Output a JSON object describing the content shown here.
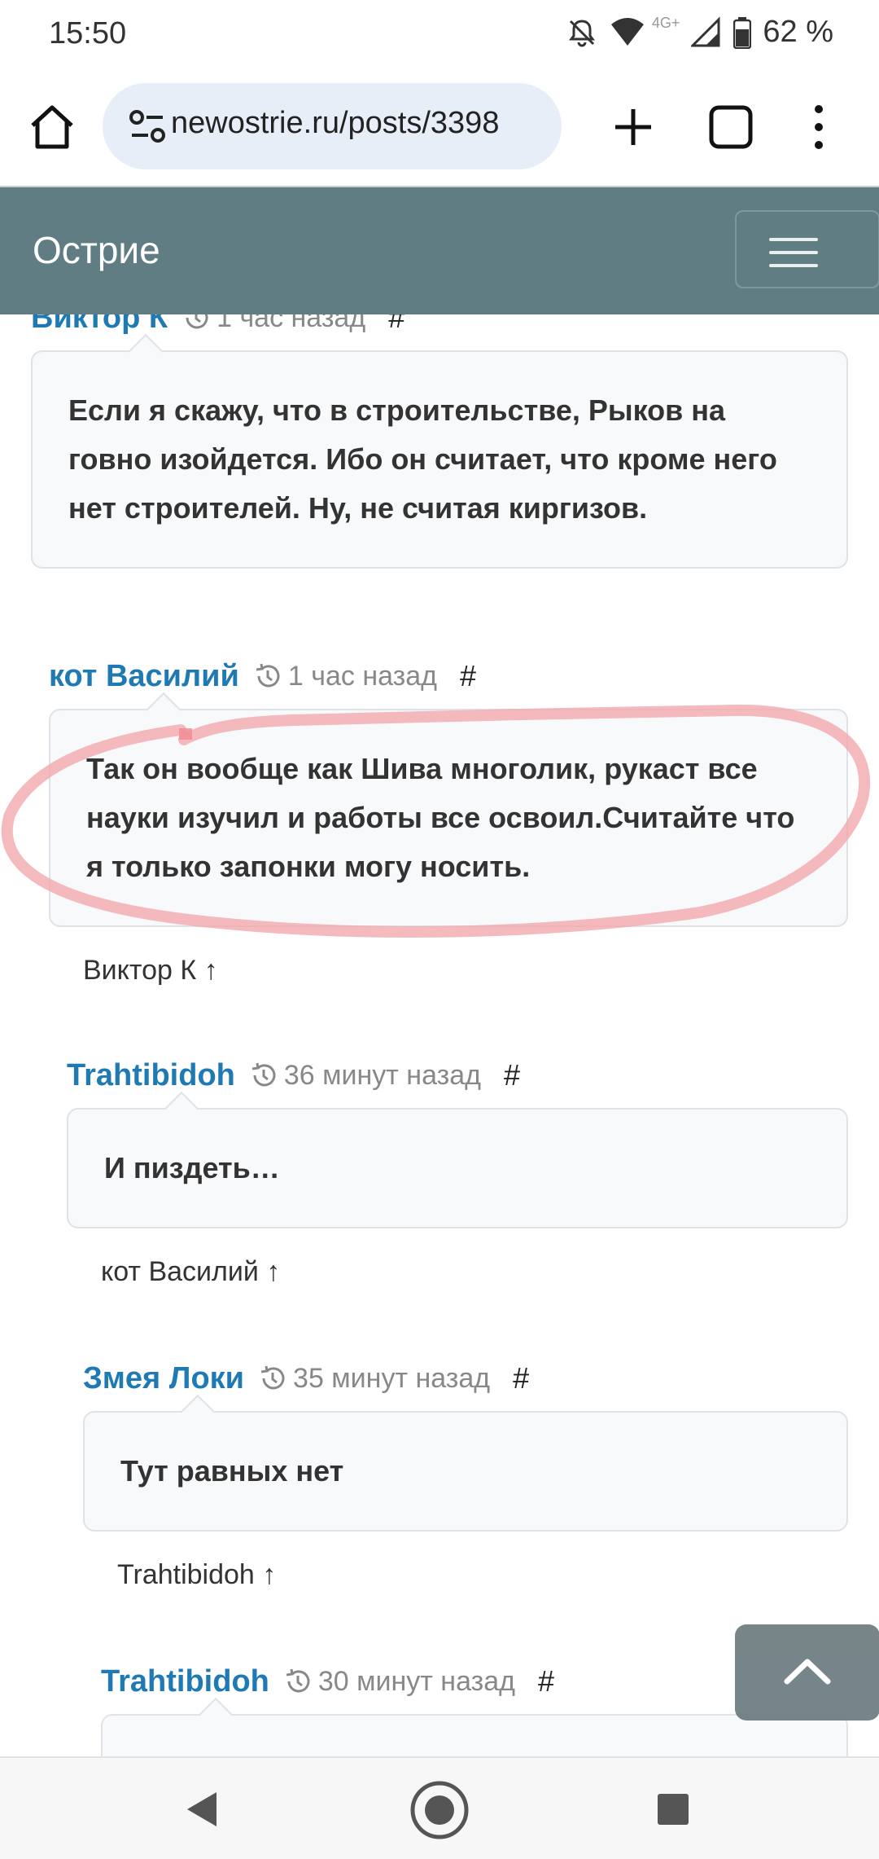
{
  "status_bar": {
    "time": "15:50",
    "network": "4G+",
    "battery": "62 %"
  },
  "browser": {
    "url": "newostrie.ru/posts/3398"
  },
  "site": {
    "title": "Острие"
  },
  "comments": [
    {
      "author": "Виктор К",
      "time": "1 час назад",
      "hash": "#",
      "text": "Если я скажу, что в строительстве, Рыков на говно изойдется. Ибо он считает, что кроме него нет строителей. Ну, не считая киргизов.",
      "reply_to": ""
    },
    {
      "author": "кот Василий",
      "time": "1 час назад",
      "hash": "#",
      "text": "Так он вообще как Шива многолик, рукаст все науки изучил и работы все освоил.Считайте что я только запонки могу носить.",
      "reply_to": "Виктор К ↑"
    },
    {
      "author": "Trahtibidoh",
      "time": "36 минут назад",
      "hash": "#",
      "text": "И пиздеть…",
      "reply_to": "кот Василий ↑"
    },
    {
      "author": "Змея Локи",
      "time": "35 минут назад",
      "hash": "#",
      "text": "Тут равных нет",
      "reply_to": "Trahtibidoh ↑"
    },
    {
      "author": "Trahtibidoh",
      "time": "30 минут назад",
      "hash": "#",
      "text": "",
      "reply_to": ""
    }
  ],
  "colors": {
    "header_bg": "#607d84",
    "author": "#1f7ab3",
    "annotation": "#f3a9ad"
  }
}
